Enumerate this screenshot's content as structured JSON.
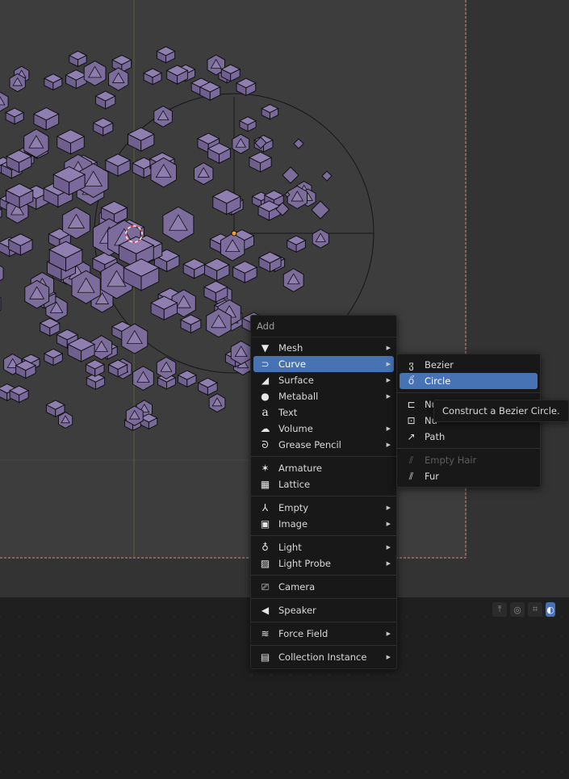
{
  "add_menu": {
    "title": "Add",
    "items": [
      {
        "label": "Mesh",
        "icon": "mesh-icon",
        "submenu": true
      },
      {
        "label": "Curve",
        "icon": "curve-icon",
        "submenu": true,
        "active": true
      },
      {
        "label": "Surface",
        "icon": "surface-icon",
        "submenu": true
      },
      {
        "label": "Metaball",
        "icon": "metaball-icon",
        "submenu": true
      },
      {
        "label": "Text",
        "icon": "text-icon",
        "submenu": false
      },
      {
        "label": "Volume",
        "icon": "volume-icon",
        "submenu": true
      },
      {
        "label": "Grease Pencil",
        "icon": "grease-pencil-icon",
        "submenu": true
      },
      {
        "label": "Armature",
        "icon": "armature-icon",
        "submenu": false
      },
      {
        "label": "Lattice",
        "icon": "lattice-icon",
        "submenu": false
      },
      {
        "label": "Empty",
        "icon": "empty-icon",
        "submenu": true
      },
      {
        "label": "Image",
        "icon": "image-icon",
        "submenu": true
      },
      {
        "label": "Light",
        "icon": "light-icon",
        "submenu": true
      },
      {
        "label": "Light Probe",
        "icon": "light-probe-icon",
        "submenu": true
      },
      {
        "label": "Camera",
        "icon": "camera-icon",
        "submenu": false
      },
      {
        "label": "Speaker",
        "icon": "speaker-icon",
        "submenu": false
      },
      {
        "label": "Force Field",
        "icon": "force-field-icon",
        "submenu": true
      },
      {
        "label": "Collection Instance",
        "icon": "collection-instance-icon",
        "submenu": true
      }
    ]
  },
  "curve_submenu": {
    "items": [
      {
        "label": "Bezier",
        "icon": "bezier-icon"
      },
      {
        "label": "Circle",
        "icon": "bezier-circle-icon",
        "active": true
      },
      {
        "label": "Nu",
        "icon": "nurbs-curve-icon"
      },
      {
        "label": "Nu",
        "icon": "nurbs-circle-icon"
      },
      {
        "label": "Path",
        "icon": "path-icon"
      },
      {
        "label": "Empty Hair",
        "icon": "empty-hair-icon",
        "disabled": true
      },
      {
        "label": "Fur",
        "icon": "fur-icon"
      }
    ]
  },
  "tooltip": "Construct a Bezier Circle.",
  "colors": {
    "accent": "#4772b3",
    "object_fill": "#7a6a9b",
    "viewport_bg": "#3d3d3d"
  }
}
